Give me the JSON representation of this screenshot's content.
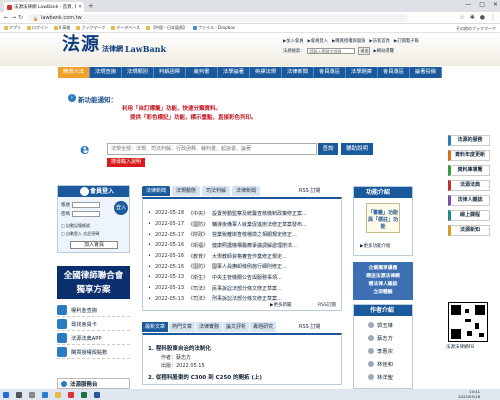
{
  "browser": {
    "tab_title": "法源法律網 LawBank - 首頁, 即時...",
    "new_tab": "+",
    "url": "lawbank.com.tw",
    "window_controls": [
      "—",
      "□",
      "✕"
    ],
    "bookmarks": [
      "アプリ",
      "ログイン",
      "Ⅱ 高雄",
      "ブックマーク",
      "データベース",
      "【中国・日本語頁】",
      "ファイル - Dropbox"
    ],
    "bookmarks_right": "その他のブックマーク"
  },
  "header": {
    "logo_chars": "法源",
    "logo_mid": "法律網",
    "logo_eng": "LawBank",
    "top_links": [
      "▶加入會員",
      "▶會員登入",
      "▶購買授權與儲值",
      "▶訪客首頁",
      "▶訂閱電子報"
    ],
    "search_label": "法規檢索：",
    "search_placeholder": "請輸入關鍵字搜尋",
    "search_btn": "送出",
    "sitemap": "▶網站導覽"
  },
  "nav": [
    "精選六法",
    "法規查詢",
    "法規類別",
    "判解函釋",
    "裁判書",
    "法學論著",
    "英譯法規",
    "法律新聞",
    "會員專區",
    "法學題庫",
    "會員專區",
    "論著投稿"
  ],
  "notice": {
    "icon": "i",
    "title": "新功能通知：",
    "line1": "利用「自訂標籤」功能，快速分類資料。",
    "line2": "提供「彩色標記」功能，標示重點，直接彩色列印。"
  },
  "search": {
    "placeholder": "法規全部：法規、司法判解、行政函釋、裁判書、起訴書、論著",
    "btn": "查詢",
    "help": "輔助說明",
    "intro": "搜尋輸入說明"
  },
  "login": {
    "title": "會員登入",
    "account": "帳號",
    "password": "密碼",
    "go": "登入",
    "remember": "□ 自動記憶帳號",
    "forgot": "□ 自動登入 忘記密碼",
    "join": "加入會員"
  },
  "banner": [
    "全國律師聯合會",
    "獨享方案"
  ],
  "left_links": [
    "權利金查詢",
    "尋找會員卡",
    "法源法典APP",
    "購買授權與點數"
  ],
  "service": "法源服務台",
  "news_tabs": [
    "法律新聞",
    "法規動態",
    "司法判解",
    "法律新聞"
  ],
  "rss1": "RSS 訂閱",
  "news": [
    {
      "date": "2022-05-18",
      "cat": "《中央》",
      "title": "設置勞動監察及統籌查核機制政策修正案..."
    },
    {
      "date": "2022-05-17",
      "cat": "《國防》",
      "title": "輔導後備軍人就業促進辦法修正草案發布..."
    },
    {
      "date": "2022-05-17",
      "cat": "《財政》",
      "title": "營業稅離岸查核稽徵之相關規定修正..."
    },
    {
      "date": "2022-05-16",
      "cat": "《衛福》",
      "title": "健康照護機構醫療爭議調解處理辦法..."
    },
    {
      "date": "2022-05-16",
      "cat": "《教育》",
      "title": "大學教師資格審查作業修正規定..."
    },
    {
      "date": "2022-05-16",
      "cat": "《國防》",
      "title": "國軍人員撫卹條例施行細則修正..."
    },
    {
      "date": "2022-05-13",
      "cat": "《衛生》",
      "title": "中央主管機關公告與服務事項..."
    },
    {
      "date": "2022-05-13",
      "cat": "《司法》",
      "title": "民事訴訟法部分條文修正草案..."
    },
    {
      "date": "2022-05-13",
      "cat": "《司法》",
      "title": "刑事訴訟法部分條文修正草案..."
    }
  ],
  "more1": "▶更多新聞",
  "rss2": "RSS訂閱",
  "art_tabs": [
    "最新文章",
    "熱門文章",
    "法律實務",
    "論文評析",
    "專題研究"
  ],
  "rss3": "RSS 訂閱",
  "article": {
    "a1": "1. 程科股東自治的法制化",
    "a2": "作者：蔡志方",
    "a3": "出版：2022.05.15",
    "a4": "2. 從程科股東的 C300 到 C250 的開拓 (上)"
  },
  "func": {
    "title": "功能介紹",
    "img": "「書籤」功能 與「標註」功能",
    "link": "▶更多功能介紹"
  },
  "ad": [
    "企業獨享優惠",
    "贈送法源法律網",
    "贈法律人雜誌",
    "立即體驗"
  ],
  "authors": {
    "title": "作者介紹",
    "list": [
      "郭玉琳",
      "蔡志方",
      "李惠宗",
      "林佳和",
      "林洋聖"
    ]
  },
  "right_links": [
    "法源的服務",
    "資料年度更新",
    "資料庫導覽",
    "法源法典",
    "法律人雜誌",
    "線上課程",
    "法源新知"
  ],
  "qr_caption": "法源法律網FB",
  "tray": [
    "14:41",
    "2022/05/18"
  ]
}
